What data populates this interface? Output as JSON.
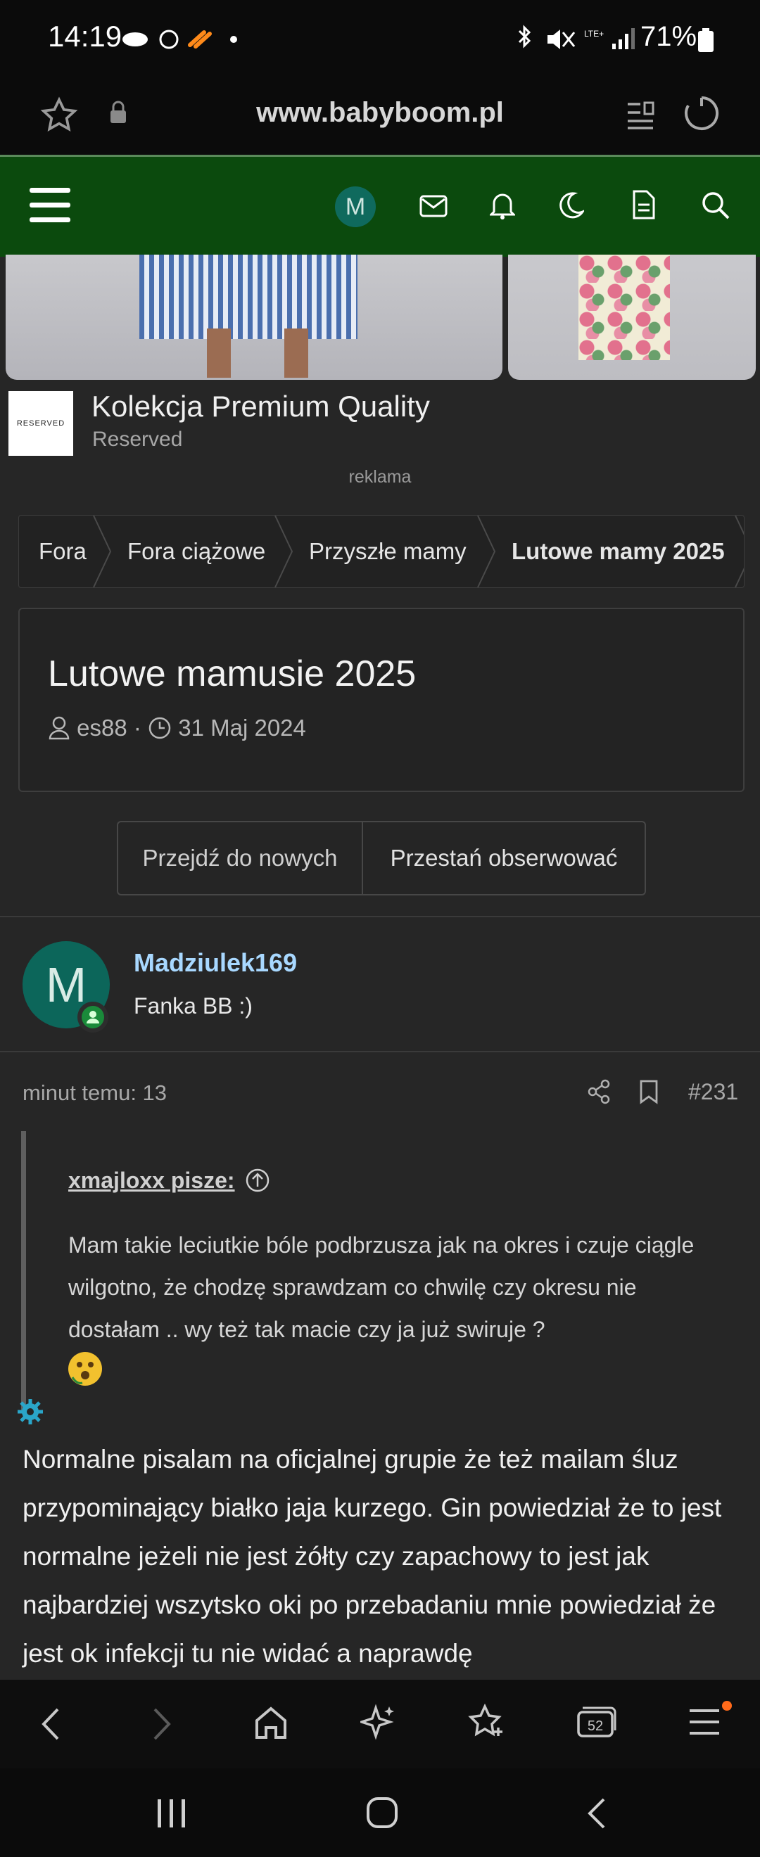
{
  "status_bar": {
    "time": "14:19",
    "battery": "71%",
    "network": "LTE+"
  },
  "browser": {
    "url": "www.babyboom.pl",
    "tab_count": "52"
  },
  "site_nav": {
    "avatar_letter": "M"
  },
  "ad": {
    "logo_text": "RESERVED",
    "title": "Kolekcja Premium Quality",
    "brand": "Reserved",
    "label": "reklama"
  },
  "breadcrumbs": [
    "Fora",
    "Fora ciążowe",
    "Przyszłe mamy",
    "Lutowe mamy 2025"
  ],
  "thread": {
    "title": "Lutowe mamusie 2025",
    "author": "es88",
    "date": "31 Maj 2024"
  },
  "buttons": {
    "go_new": "Przejdź do nowych",
    "unwatch": "Przestań obserwować"
  },
  "post": {
    "avatar_letter": "M",
    "username": "Madziulek169",
    "role": "Fanka BB :)",
    "time": "minut temu: 13",
    "number": "#231",
    "quote_author": "xmajloxx pisze:",
    "quote_text": "Mam takie leciutkie bóle podbrzusza jak na okres i czuje ciągle wilgotno, że chodzę sprawdzam co chwilę czy okresu nie dostałam .. wy też tak macie czy ja już swiruje ?",
    "body": "Normalne pisalam na oficjalnej grupie że też mailam śluz przypominający białko jaja kurzego. Gin powiedział że to jest normalne jeżeli nie jest żółty czy zapachowy to jest jak najbardziej wszytsko oki po przebadaniu mnie powiedział że jest ok infekcji tu nie widać a naprawdę"
  },
  "colors": {
    "nav_green": "#0b4a0d",
    "username_blue": "#a8d8ff",
    "avatar_teal": "#0c665a"
  }
}
